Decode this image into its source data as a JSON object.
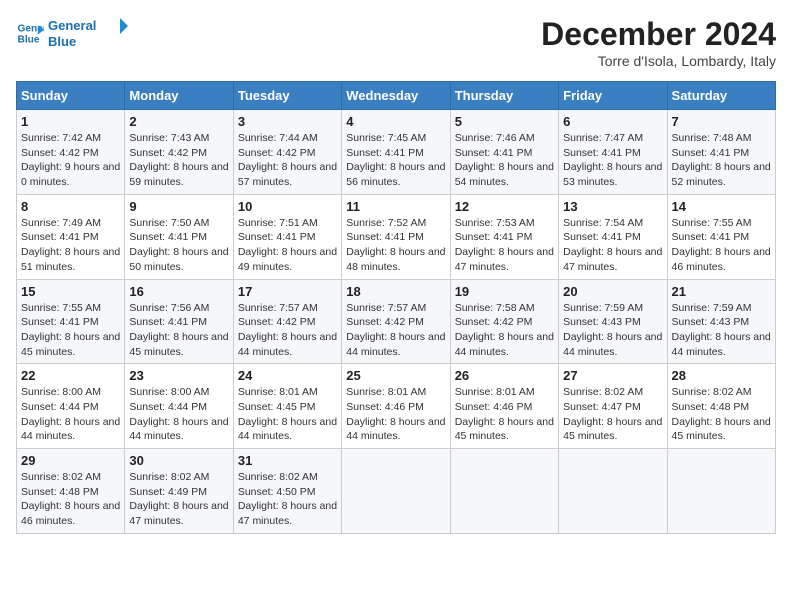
{
  "logo": {
    "line1": "General",
    "line2": "Blue"
  },
  "title": "December 2024",
  "location": "Torre d'Isola, Lombardy, Italy",
  "weekdays": [
    "Sunday",
    "Monday",
    "Tuesday",
    "Wednesday",
    "Thursday",
    "Friday",
    "Saturday"
  ],
  "weeks": [
    [
      {
        "day": "1",
        "sunrise": "7:42 AM",
        "sunset": "4:42 PM",
        "daylight": "9 hours and 0 minutes."
      },
      {
        "day": "2",
        "sunrise": "7:43 AM",
        "sunset": "4:42 PM",
        "daylight": "8 hours and 59 minutes."
      },
      {
        "day": "3",
        "sunrise": "7:44 AM",
        "sunset": "4:42 PM",
        "daylight": "8 hours and 57 minutes."
      },
      {
        "day": "4",
        "sunrise": "7:45 AM",
        "sunset": "4:41 PM",
        "daylight": "8 hours and 56 minutes."
      },
      {
        "day": "5",
        "sunrise": "7:46 AM",
        "sunset": "4:41 PM",
        "daylight": "8 hours and 54 minutes."
      },
      {
        "day": "6",
        "sunrise": "7:47 AM",
        "sunset": "4:41 PM",
        "daylight": "8 hours and 53 minutes."
      },
      {
        "day": "7",
        "sunrise": "7:48 AM",
        "sunset": "4:41 PM",
        "daylight": "8 hours and 52 minutes."
      }
    ],
    [
      {
        "day": "8",
        "sunrise": "7:49 AM",
        "sunset": "4:41 PM",
        "daylight": "8 hours and 51 minutes."
      },
      {
        "day": "9",
        "sunrise": "7:50 AM",
        "sunset": "4:41 PM",
        "daylight": "8 hours and 50 minutes."
      },
      {
        "day": "10",
        "sunrise": "7:51 AM",
        "sunset": "4:41 PM",
        "daylight": "8 hours and 49 minutes."
      },
      {
        "day": "11",
        "sunrise": "7:52 AM",
        "sunset": "4:41 PM",
        "daylight": "8 hours and 48 minutes."
      },
      {
        "day": "12",
        "sunrise": "7:53 AM",
        "sunset": "4:41 PM",
        "daylight": "8 hours and 47 minutes."
      },
      {
        "day": "13",
        "sunrise": "7:54 AM",
        "sunset": "4:41 PM",
        "daylight": "8 hours and 47 minutes."
      },
      {
        "day": "14",
        "sunrise": "7:55 AM",
        "sunset": "4:41 PM",
        "daylight": "8 hours and 46 minutes."
      }
    ],
    [
      {
        "day": "15",
        "sunrise": "7:55 AM",
        "sunset": "4:41 PM",
        "daylight": "8 hours and 45 minutes."
      },
      {
        "day": "16",
        "sunrise": "7:56 AM",
        "sunset": "4:41 PM",
        "daylight": "8 hours and 45 minutes."
      },
      {
        "day": "17",
        "sunrise": "7:57 AM",
        "sunset": "4:42 PM",
        "daylight": "8 hours and 44 minutes."
      },
      {
        "day": "18",
        "sunrise": "7:57 AM",
        "sunset": "4:42 PM",
        "daylight": "8 hours and 44 minutes."
      },
      {
        "day": "19",
        "sunrise": "7:58 AM",
        "sunset": "4:42 PM",
        "daylight": "8 hours and 44 minutes."
      },
      {
        "day": "20",
        "sunrise": "7:59 AM",
        "sunset": "4:43 PM",
        "daylight": "8 hours and 44 minutes."
      },
      {
        "day": "21",
        "sunrise": "7:59 AM",
        "sunset": "4:43 PM",
        "daylight": "8 hours and 44 minutes."
      }
    ],
    [
      {
        "day": "22",
        "sunrise": "8:00 AM",
        "sunset": "4:44 PM",
        "daylight": "8 hours and 44 minutes."
      },
      {
        "day": "23",
        "sunrise": "8:00 AM",
        "sunset": "4:44 PM",
        "daylight": "8 hours and 44 minutes."
      },
      {
        "day": "24",
        "sunrise": "8:01 AM",
        "sunset": "4:45 PM",
        "daylight": "8 hours and 44 minutes."
      },
      {
        "day": "25",
        "sunrise": "8:01 AM",
        "sunset": "4:46 PM",
        "daylight": "8 hours and 44 minutes."
      },
      {
        "day": "26",
        "sunrise": "8:01 AM",
        "sunset": "4:46 PM",
        "daylight": "8 hours and 45 minutes."
      },
      {
        "day": "27",
        "sunrise": "8:02 AM",
        "sunset": "4:47 PM",
        "daylight": "8 hours and 45 minutes."
      },
      {
        "day": "28",
        "sunrise": "8:02 AM",
        "sunset": "4:48 PM",
        "daylight": "8 hours and 45 minutes."
      }
    ],
    [
      {
        "day": "29",
        "sunrise": "8:02 AM",
        "sunset": "4:48 PM",
        "daylight": "8 hours and 46 minutes."
      },
      {
        "day": "30",
        "sunrise": "8:02 AM",
        "sunset": "4:49 PM",
        "daylight": "8 hours and 47 minutes."
      },
      {
        "day": "31",
        "sunrise": "8:02 AM",
        "sunset": "4:50 PM",
        "daylight": "8 hours and 47 minutes."
      },
      null,
      null,
      null,
      null
    ]
  ],
  "labels": {
    "sunrise": "Sunrise:",
    "sunset": "Sunset:",
    "daylight": "Daylight:"
  }
}
